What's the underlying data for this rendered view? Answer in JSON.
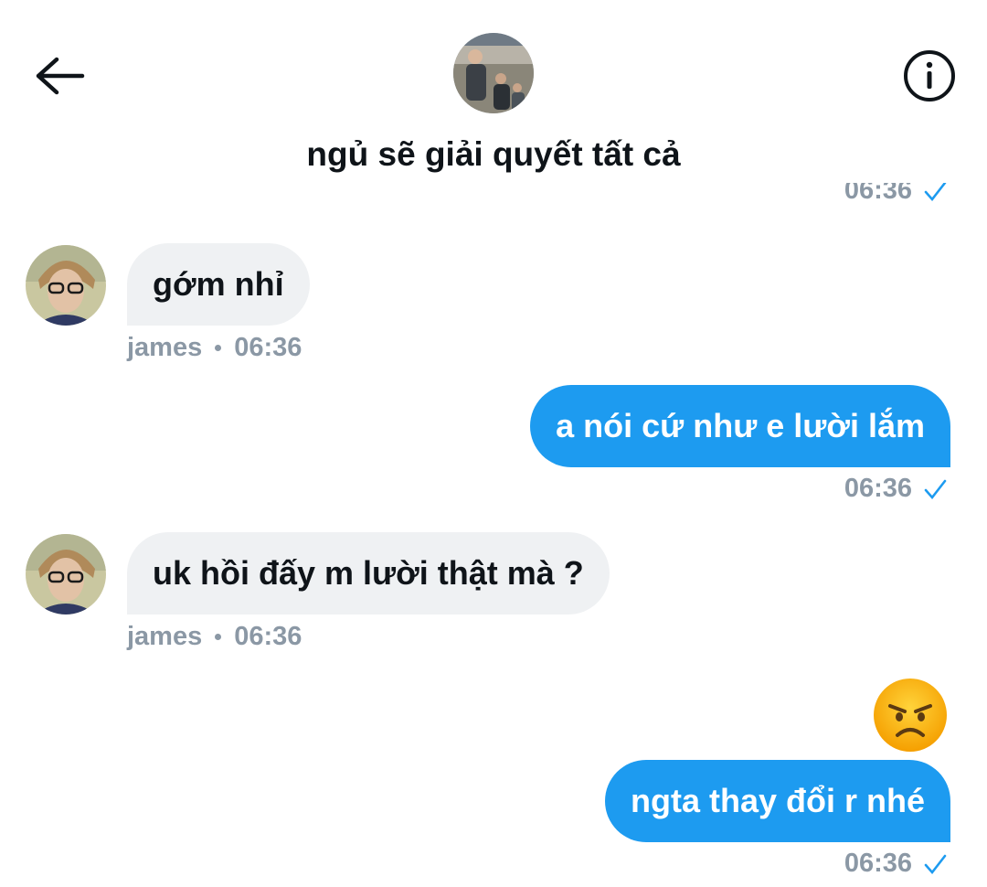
{
  "header": {
    "title": "ngủ sẽ giải quyết tất cả",
    "back_icon": "arrow-left-icon",
    "info_icon": "info-circle-icon"
  },
  "colors": {
    "accent": "#1d9bf0",
    "incoming_bubble": "#eff1f3",
    "meta_text": "#8b98a5"
  },
  "messages": [
    {
      "direction": "out",
      "time": "06:36",
      "status": "sent",
      "clipped": true
    },
    {
      "direction": "in",
      "text": "gớm nhỉ",
      "sender": "james",
      "time": "06:36"
    },
    {
      "direction": "out",
      "text": "a nói cứ như e lười lắm",
      "time": "06:36",
      "status": "sent"
    },
    {
      "direction": "in",
      "text": "uk hồi đấy m lười thật mà ?",
      "sender": "james",
      "time": "06:36"
    },
    {
      "direction": "out",
      "emoji": "angry-face",
      "text": "ngta thay đổi r nhé",
      "time": "06:36",
      "status": "sent"
    }
  ]
}
